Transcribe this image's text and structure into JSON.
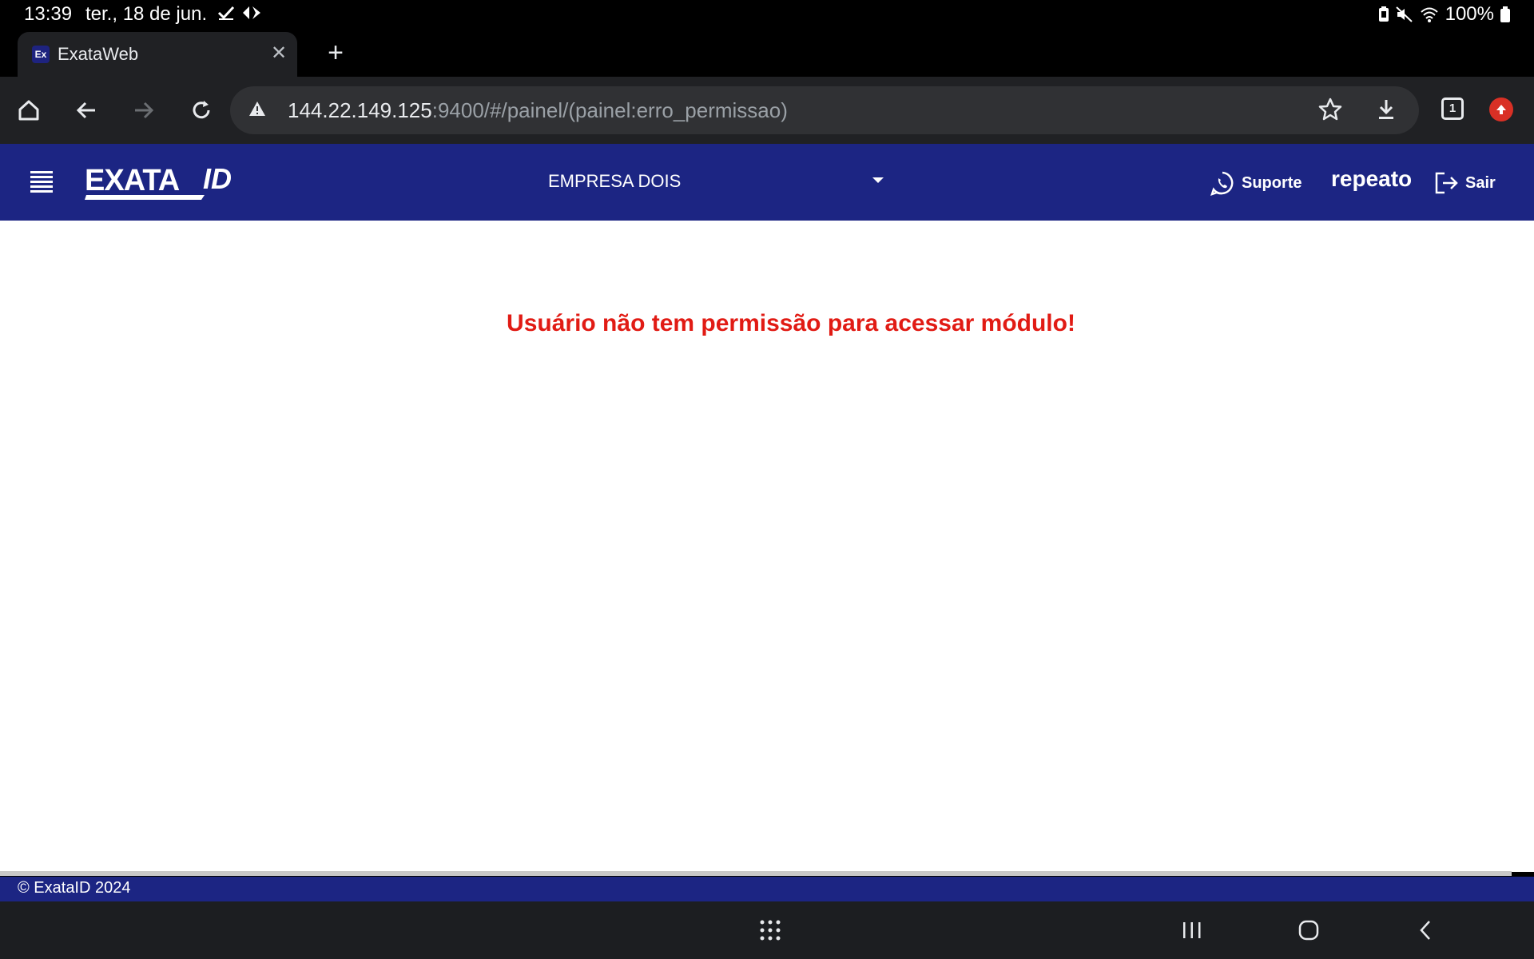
{
  "status_bar": {
    "time": "13:39",
    "date": "ter., 18 de jun.",
    "battery": "100%"
  },
  "browser": {
    "tab": {
      "favicon_text": "Ex",
      "title": "ExataWeb"
    },
    "tab_count": "1",
    "url_host": "144.22.149.125",
    "url_rest": ":9400/#/painel/(painel:erro_permissao)"
  },
  "app": {
    "logo_text": "EXATA",
    "logo_suffix": "ID",
    "company": "EMPRESA DOIS",
    "support_label": "Suporte",
    "username": "repeato",
    "logout_label": "Sair",
    "error_message": "Usuário não tem permissão para acessar módulo!",
    "footer": "© ExataID 2024"
  },
  "colors": {
    "header_bg": "#1c2583",
    "error": "#e11b14",
    "browser_bg": "#202124"
  }
}
